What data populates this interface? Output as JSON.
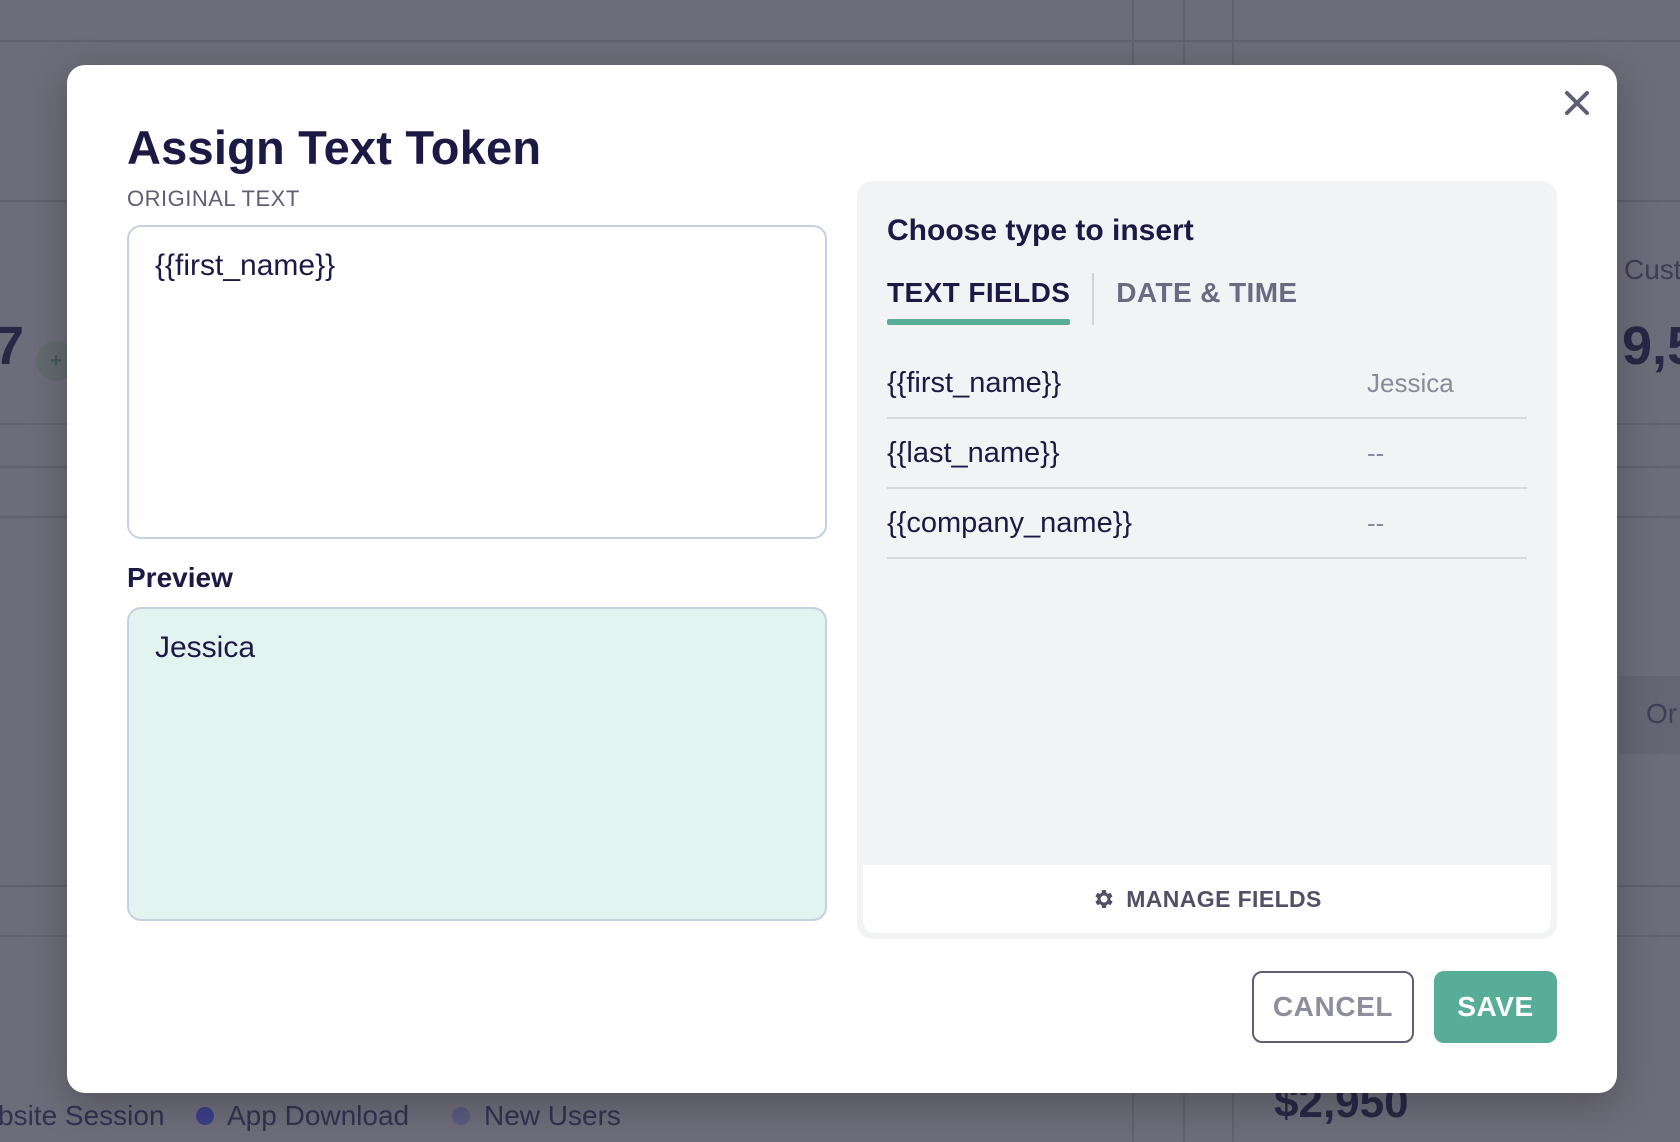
{
  "background": {
    "right_label_top": "Cust",
    "right_big_value": "9,5",
    "left_big_value": "7",
    "left_pill": "+",
    "right_label_mid": "Or",
    "legend": [
      {
        "label": "bsite Session",
        "color": ""
      },
      {
        "label": "App Download",
        "color": "#3b3f86"
      },
      {
        "label": "New Users",
        "color": "#5a5b7e"
      }
    ],
    "bottom_amount": "$2,950"
  },
  "modal": {
    "title": "Assign Text Token",
    "original_label": "ORIGINAL TEXT",
    "original_text": "{{first_name}}",
    "preview_label": "Preview",
    "preview_text": "Jessica",
    "close_icon": "close-icon"
  },
  "panel": {
    "title": "Choose type to insert",
    "tabs": [
      {
        "label": "TEXT FIELDS",
        "active": true
      },
      {
        "label": "DATE & TIME",
        "active": false
      }
    ],
    "fields": [
      {
        "token": "{{first_name}}",
        "value": "Jessica"
      },
      {
        "token": "{{last_name}}",
        "value": "--"
      },
      {
        "token": "{{company_name}}",
        "value": "--"
      }
    ],
    "manage_label": "MANAGE FIELDS",
    "manage_icon": "gear-icon"
  },
  "actions": {
    "cancel_label": "CANCEL",
    "save_label": "SAVE"
  },
  "colors": {
    "accent": "#58ad98",
    "preview_bg": "#e3f3ef",
    "title": "#1c1945"
  }
}
